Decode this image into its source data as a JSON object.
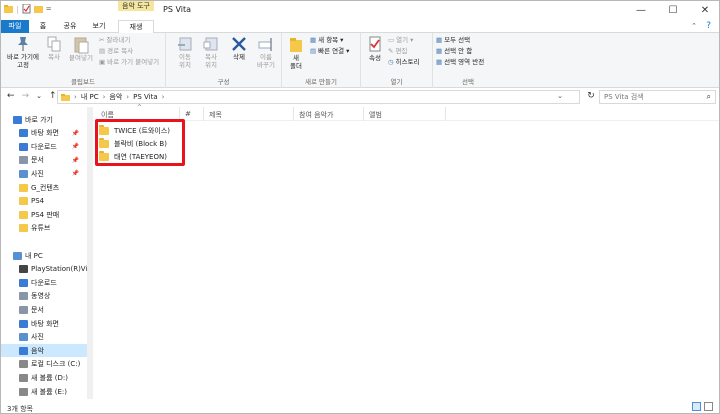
{
  "window": {
    "title": "PS Vita",
    "context_tab": "음악 도구",
    "controls": {
      "minimize": "—",
      "maximize": "☐",
      "close": "✕"
    }
  },
  "quick_access": {
    "dropdown": "=",
    "separator": "|"
  },
  "tabs": [
    {
      "label": "파일"
    },
    {
      "label": "홈"
    },
    {
      "label": "공유"
    },
    {
      "label": "보기"
    },
    {
      "label": "재생"
    }
  ],
  "ribbon": {
    "clipboard": {
      "group_label": "클립보드",
      "pin_label": "바로 가기에\n고정",
      "copy_label": "복사",
      "paste_label": "붙여넣기",
      "cut_label": "잘라내기",
      "copy_path_label": "경로 복사",
      "paste_shortcut_label": "바로 가기 붙여넣기"
    },
    "organize": {
      "group_label": "구성",
      "move_label": "이동\n위치",
      "copy_to_label": "복사\n위치",
      "delete_label": "삭제",
      "rename_label": "이름\n바꾸기"
    },
    "new": {
      "group_label": "새로 만들기",
      "new_folder_label": "새\n폴더",
      "new_item_label": "새 항목",
      "easy_access_label": "빠른 연결"
    },
    "open": {
      "group_label": "열기",
      "properties_label": "속성",
      "open_label": "열기",
      "edit_label": "편집",
      "history_label": "히스토리"
    },
    "select": {
      "group_label": "선택",
      "select_all_label": "모두 선택",
      "select_none_label": "선택 안 함",
      "invert_label": "선택 영역 반전"
    }
  },
  "address": {
    "crumbs": [
      "내 PC",
      "음악",
      "PS Vita"
    ],
    "sep": "›",
    "dropdown": "⌄",
    "refresh": "↻",
    "search_placeholder": "PS Vita 검색",
    "search_icon": "⌕",
    "nav": {
      "back": "←",
      "forward": "→",
      "recent": "⌄",
      "up": "↑"
    }
  },
  "nav_pane": {
    "items": [
      {
        "label": "바로 가기",
        "icon": "star-icon",
        "level": 0,
        "pinned": false
      },
      {
        "label": "바탕 화면",
        "icon": "desktop-icon",
        "level": 1,
        "pinned": true
      },
      {
        "label": "다운로드",
        "icon": "download-icon",
        "level": 1,
        "pinned": true
      },
      {
        "label": "문서",
        "icon": "documents-icon",
        "level": 1,
        "pinned": true
      },
      {
        "label": "사진",
        "icon": "pictures-icon",
        "level": 1,
        "pinned": true
      },
      {
        "label": "G_컨텐츠",
        "icon": "folder-icon",
        "level": 1,
        "pinned": false
      },
      {
        "label": "PS4",
        "icon": "folder-icon",
        "level": 1,
        "pinned": false
      },
      {
        "label": "PS4 판매",
        "icon": "folder-icon",
        "level": 1,
        "pinned": false
      },
      {
        "label": "유튜브",
        "icon": "folder-icon",
        "level": 1,
        "pinned": false
      },
      {
        "label": "",
        "icon": "",
        "level": 0,
        "pinned": false
      },
      {
        "label": "내 PC",
        "icon": "pc-icon",
        "level": 0,
        "pinned": false
      },
      {
        "label": "PlayStation(R)Vi",
        "icon": "device-icon",
        "level": 1,
        "pinned": false
      },
      {
        "label": "다운로드",
        "icon": "download-icon",
        "level": 1,
        "pinned": false
      },
      {
        "label": "동영상",
        "icon": "videos-icon",
        "level": 1,
        "pinned": false
      },
      {
        "label": "문서",
        "icon": "documents-icon",
        "level": 1,
        "pinned": false
      },
      {
        "label": "바탕 화면",
        "icon": "desktop-icon",
        "level": 1,
        "pinned": false
      },
      {
        "label": "사진",
        "icon": "pictures-icon",
        "level": 1,
        "pinned": false
      },
      {
        "label": "음악",
        "icon": "music-icon",
        "level": 1,
        "pinned": false,
        "selected": true
      },
      {
        "label": "로컬 디스크 (C:)",
        "icon": "drive-icon",
        "level": 1,
        "pinned": false
      },
      {
        "label": "새 볼륨 (D:)",
        "icon": "drive-icon",
        "level": 1,
        "pinned": false
      },
      {
        "label": "새 볼륨 (E:)",
        "icon": "drive-icon",
        "level": 1,
        "pinned": false
      }
    ],
    "pin_glyph": "📌"
  },
  "columns": {
    "name": "이름",
    "num": "#",
    "title": "제목",
    "artist": "참여 음악가",
    "album": "앨범",
    "sort_glyph": "^"
  },
  "files": [
    {
      "name": "TWICE (트와이스)"
    },
    {
      "name": "블락비 (Block B)"
    },
    {
      "name": "태연 (TAEYEON)"
    }
  ],
  "status": {
    "count": "3개 항목"
  },
  "colors": {
    "accent": "#1979ca",
    "highlight": "#e8131d",
    "selected": "#cce8ff",
    "context_tab": "#f6e59c"
  }
}
